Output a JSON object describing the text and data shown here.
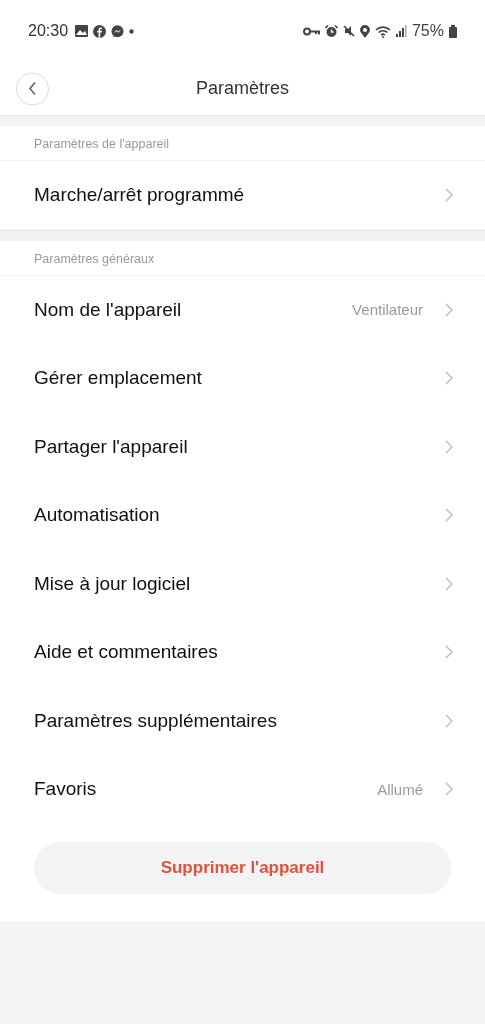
{
  "status_bar": {
    "time": "20:30",
    "battery": "75%"
  },
  "header": {
    "title": "Paramètres"
  },
  "sections": [
    {
      "title": "Paramètres de l'appareil",
      "items": [
        {
          "label": "Marche/arrêt programmé"
        }
      ]
    },
    {
      "title": "Paramètres généraux",
      "items": [
        {
          "label": "Nom de l'appareil",
          "value": "Ventilateur"
        },
        {
          "label": "Gérer emplacement"
        },
        {
          "label": "Partager l'appareil"
        },
        {
          "label": "Automatisation"
        },
        {
          "label": "Mise à jour logiciel"
        },
        {
          "label": "Aide et commentaires"
        },
        {
          "label": "Paramètres supplémentaires"
        },
        {
          "label": "Favoris",
          "value": "Allumé"
        }
      ]
    }
  ],
  "delete_button": "Supprimer l'appareil"
}
